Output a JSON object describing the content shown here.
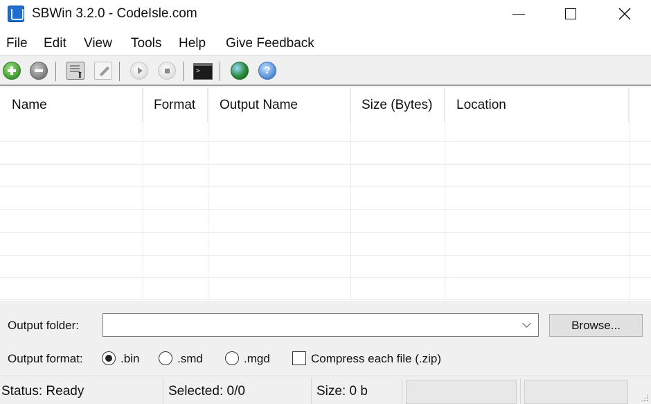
{
  "window": {
    "title": "SBWin 3.2.0 - CodeIsle.com",
    "app_icon": "sbwin-app-icon",
    "controls": [
      "minimize",
      "maximize",
      "close"
    ]
  },
  "menu": {
    "items": [
      {
        "label": "File"
      },
      {
        "label": "Edit"
      },
      {
        "label": "View"
      },
      {
        "label": "Tools"
      },
      {
        "label": "Help"
      },
      {
        "label": "Give Feedback"
      }
    ]
  },
  "toolbar": {
    "buttons": [
      {
        "name": "add",
        "icon": "add-icon"
      },
      {
        "name": "remove",
        "icon": "remove-icon"
      },
      {
        "name": "properties",
        "icon": "properties-icon"
      },
      {
        "name": "edit",
        "icon": "edit-icon"
      },
      {
        "name": "play",
        "icon": "play-icon"
      },
      {
        "name": "stop",
        "icon": "stop-icon"
      },
      {
        "name": "console",
        "icon": "console-icon"
      },
      {
        "name": "website",
        "icon": "globe-icon"
      },
      {
        "name": "help",
        "icon": "help-icon"
      }
    ]
  },
  "file_list": {
    "columns": [
      {
        "label": "Name"
      },
      {
        "label": "Format"
      },
      {
        "label": "Output Name"
      },
      {
        "label": "Size (Bytes)"
      },
      {
        "label": "Location"
      }
    ],
    "rows": []
  },
  "output": {
    "folder_label": "Output folder:",
    "folder_value": "",
    "browse_label": "Browse...",
    "format_label": "Output format:",
    "formats": [
      {
        "label": ".bin",
        "checked": true
      },
      {
        "label": ".smd",
        "checked": false
      },
      {
        "label": ".mgd",
        "checked": false
      }
    ],
    "compress_label": "Compress each file (.zip)",
    "compress_checked": false
  },
  "status": {
    "status_text": "Status: Ready",
    "selected_text": "Selected:  0/0",
    "size_text": "Size:  0 b"
  },
  "colors": {
    "window_bg": "#f0f0f0",
    "list_bg": "#ffffff",
    "gridline": "#ececec"
  }
}
